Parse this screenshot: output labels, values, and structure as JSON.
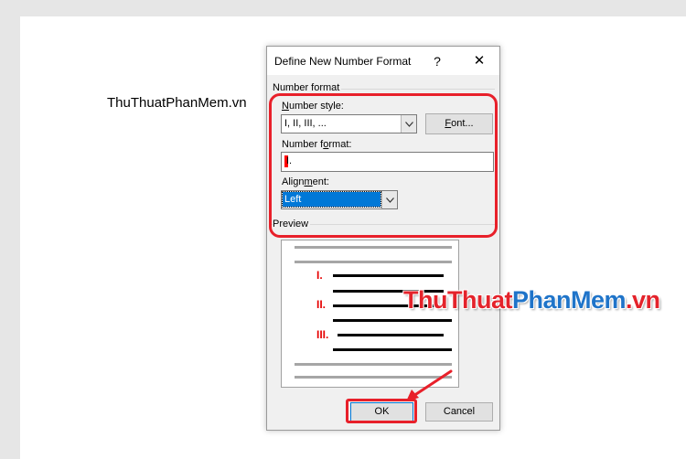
{
  "document": {
    "body_text": "ThuThuatPhanMem.vn"
  },
  "watermark": {
    "part_a": "ThuThuat",
    "part_b": "PhanMem",
    "part_c": ".vn"
  },
  "dialog": {
    "title": "Define New Number Format",
    "help_label": "?",
    "close_label": "✕",
    "number_format_group": "Number format",
    "number_style": {
      "label_key": "N",
      "label_rest": "umber style:",
      "value": "I, II, III, ..."
    },
    "font_button": {
      "label_key": "F",
      "label_rest": "ont..."
    },
    "number_format": {
      "label_pre": "Number f",
      "label_key": "o",
      "label_rest": "rmat:",
      "value": "I."
    },
    "alignment": {
      "label_pre": "Align",
      "label_key": "m",
      "label_rest": "ent:",
      "value": "Left"
    },
    "preview_label": "Preview",
    "preview_numbers": [
      "I.",
      "II.",
      "III."
    ],
    "ok_label": "OK",
    "cancel_label": "Cancel"
  },
  "colors": {
    "highlight": "#e8202a",
    "selection": "#0078d7",
    "watermark_red": "#e4232b",
    "watermark_blue": "#1f74c9"
  },
  "icons": {
    "dropdown": "chevron-down-icon",
    "close": "close-icon",
    "arrow": "red-arrow-icon"
  }
}
